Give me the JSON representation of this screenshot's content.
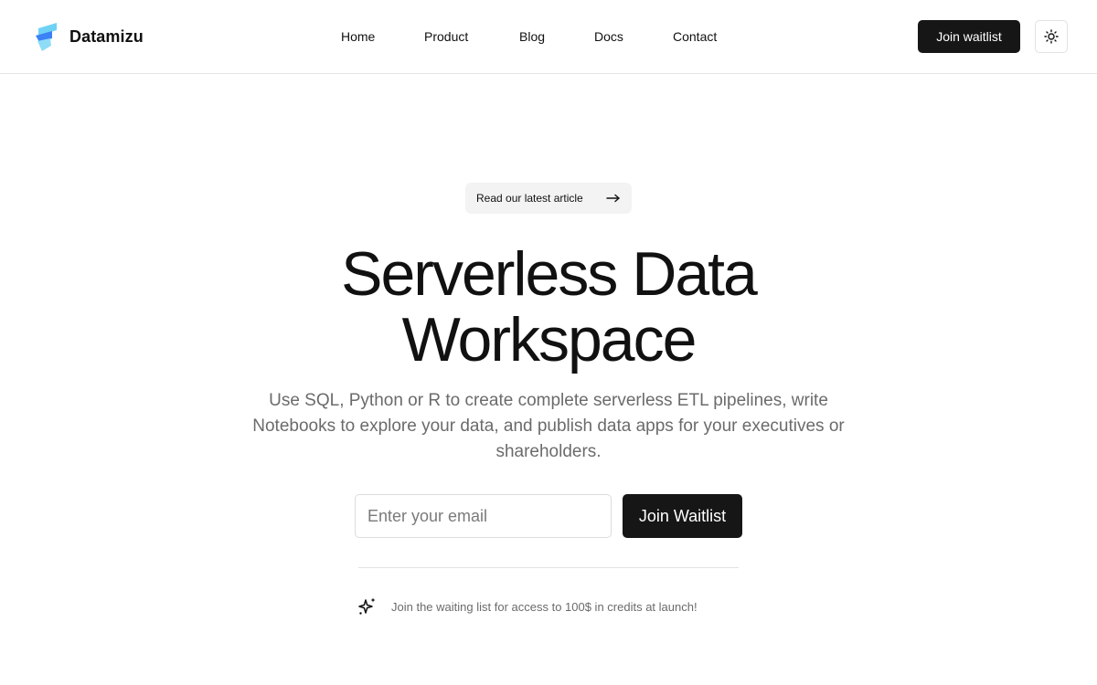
{
  "brand": {
    "name": "Datamizu",
    "logo_icon": "datamizu-logo-icon",
    "colors": {
      "light_blue": "#6fd2f5",
      "blue": "#3b82f6"
    }
  },
  "nav": {
    "items": [
      {
        "label": "Home"
      },
      {
        "label": "Product"
      },
      {
        "label": "Blog"
      },
      {
        "label": "Docs"
      },
      {
        "label": "Contact"
      }
    ]
  },
  "header": {
    "cta_label": "Join waitlist",
    "theme_toggle_icon": "sun-icon"
  },
  "hero": {
    "announcement": {
      "label": "Read our latest article",
      "icon": "arrow-right-icon"
    },
    "title_line1": "Serverless Data",
    "title_line2": "Workspace",
    "subtitle": "Use SQL, Python or R to create complete serverless ETL pipelines, write Notebooks to explore your data, and publish data apps for your executives or shareholders."
  },
  "signup": {
    "email": {
      "value": "",
      "placeholder": "Enter your email"
    },
    "button_label": "Join Waitlist"
  },
  "note": {
    "icon": "sparkles-icon",
    "text": "Join the waiting list for access to 100$ in credits at launch!"
  },
  "colors": {
    "primary_button": "#161616",
    "muted_text": "#6b6b6b",
    "border": "#e5e5e5"
  }
}
